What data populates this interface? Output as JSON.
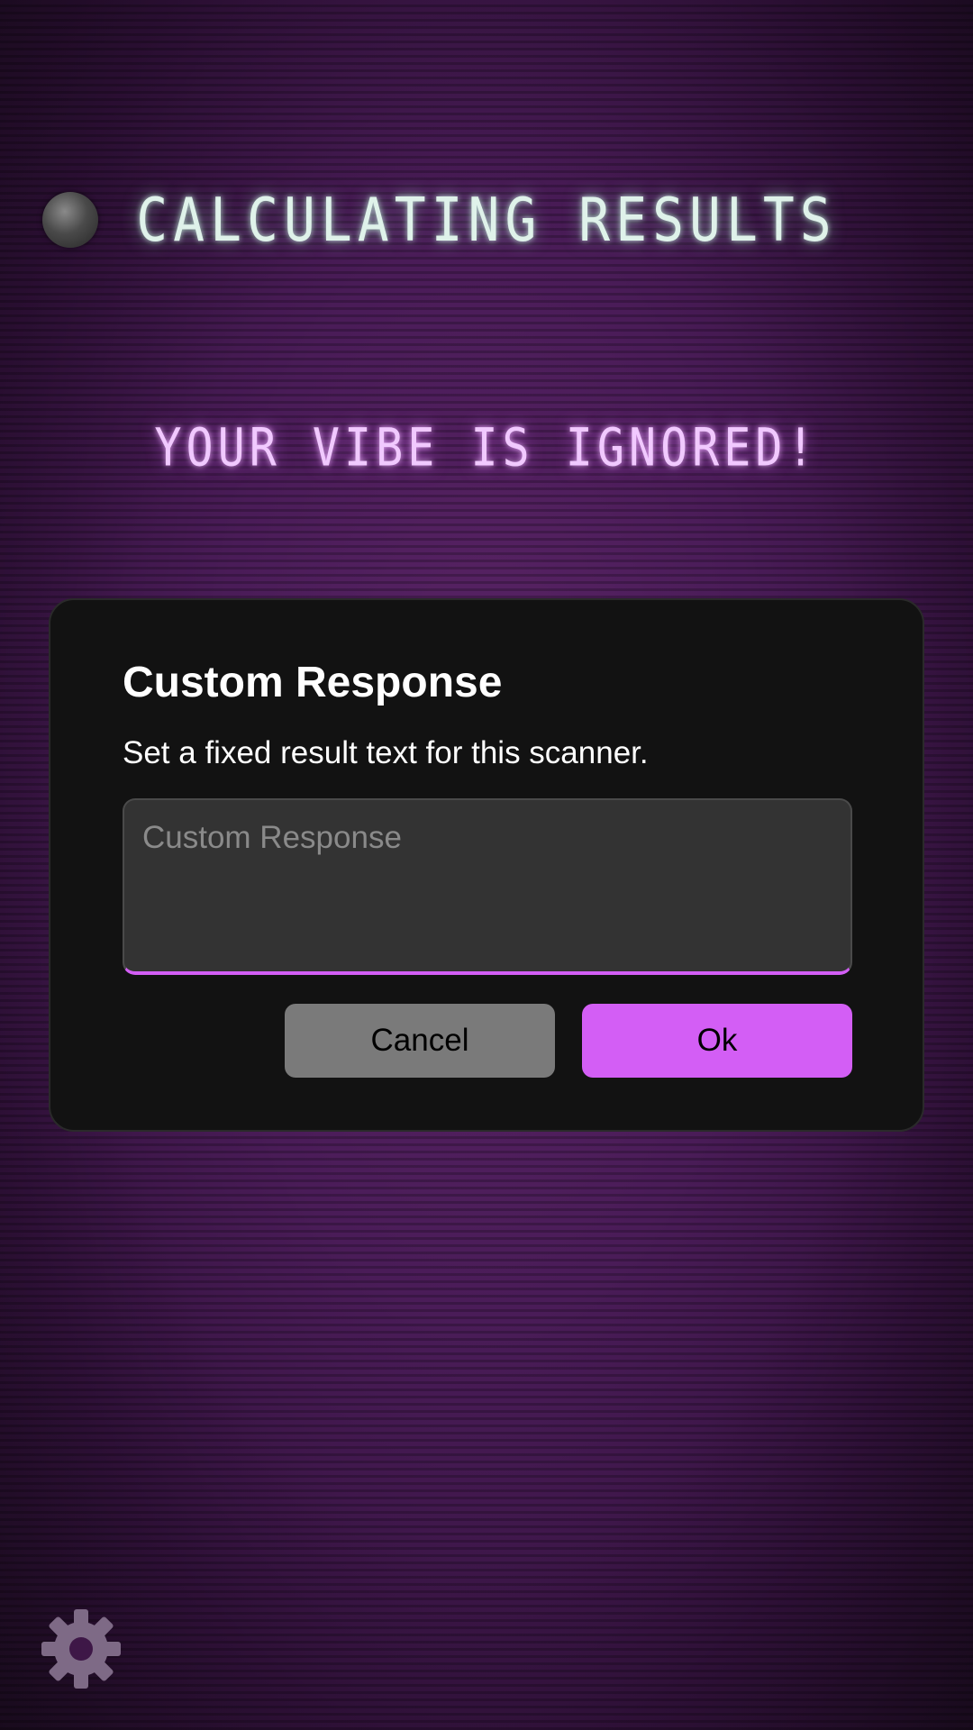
{
  "screen": {
    "headline": "CALCULATING RESULTS",
    "result_text": "YOUR VIBE IS IGNORED!"
  },
  "dialog": {
    "title": "Custom Response",
    "description": "Set a fixed result text for this scanner.",
    "input": {
      "value": "",
      "placeholder": "Custom Response"
    },
    "cancel_label": "Cancel",
    "ok_label": "Ok"
  },
  "icons": {
    "settings": "gear-icon",
    "status": "status-orb"
  },
  "colors": {
    "accent": "#d35ef5",
    "cancel_button": "#7a7a7a",
    "dialog_background": "#121212",
    "headline_glow": "#dff2ea",
    "result_glow": "#f1c9ff"
  }
}
